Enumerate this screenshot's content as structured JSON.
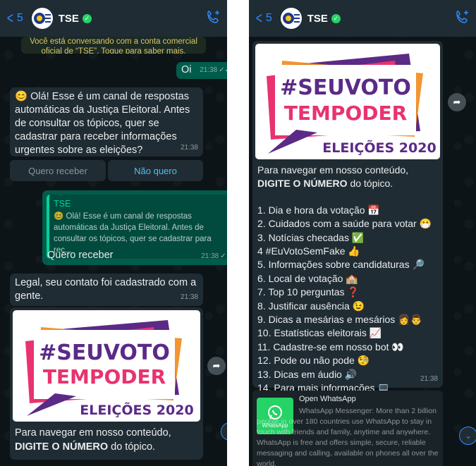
{
  "header": {
    "back_count": "5",
    "contact_name": "TSE"
  },
  "left": {
    "system_note": "Você está conversando com a conta comercial oficial de “TSE”. Toque para saber mais.",
    "msg_oi": {
      "text": "Oi",
      "time": "21:38"
    },
    "msg_welcome": {
      "text": "😊 Olá! Esse é um canal de respostas automáticas da Justiça Eleitoral. Antes de consultar os tópicos, quer se cadastrar para receber informações urgentes sobre as eleições?",
      "time": "21:38"
    },
    "quick_replies": [
      "Quero receber",
      "Não quero"
    ],
    "reply": {
      "quote_name": "TSE",
      "quote_text": "😊 Olá! Esse é um canal de respostas automáticas da Justiça Eleitoral. Antes de consultar os tópicos, quer se cadastrar para rec...",
      "text": "Quero receber",
      "time": "21:38"
    },
    "msg_registered": {
      "text": "Legal, seu contato foi cadastrado com a gente.",
      "time": "21:38"
    },
    "poster_caption_1": "Para navegar em nosso conteúdo,",
    "poster_caption_2": "DIGITE O NÚMERO",
    "poster_caption_3": " do tópico."
  },
  "poster": {
    "line1": "#SEUVOTO",
    "line2": "TEMPODER",
    "line3": "ELEIÇÕES 2020"
  },
  "right": {
    "topics": [
      "1. Dia e hora da votação 📅",
      "2. Cuidados com a saúde para votar 😷",
      "3. Notícias checadas ✅",
      "4 #EuVotoSemFake 👍",
      "5. Informações sobre candidaturas 🔎",
      "6. Local de votação 🏫",
      "7. Top 10 perguntas ❓",
      "8. Justificar ausência 😉",
      "9. Dicas a mesárias e mesários 👩👨",
      "10. Estatísticas eleitorais 📈",
      "11. Cadastre-se em nosso bot 👀",
      "12. Pode ou não pode 🧐",
      "13. Dicas em áudio 🔊",
      "14. Para mais informações 💻"
    ],
    "topics_time": "21:38",
    "link_title": "Open WhatsApp",
    "link_desc": "WhatsApp Messenger: More than 2 billion people in over 180 countries use WhatsApp to stay in touch with friends and family, anytime and anywhere. WhatsApp is free and offers simple, secure, reliable messaging and calling, available on phones all over the world.",
    "link_icon_label": "WhatsApp"
  },
  "colors": {
    "header_bg": "#1f2c34",
    "incoming_bubble": "#202c33",
    "outgoing_bubble": "#005c4b",
    "link_blue": "#2f8cff",
    "poster_purple": "#5b2a86",
    "poster_pink": "#e8336e",
    "poster_orange": "#f28a1b",
    "poster_yellow": "#f7c51f"
  }
}
